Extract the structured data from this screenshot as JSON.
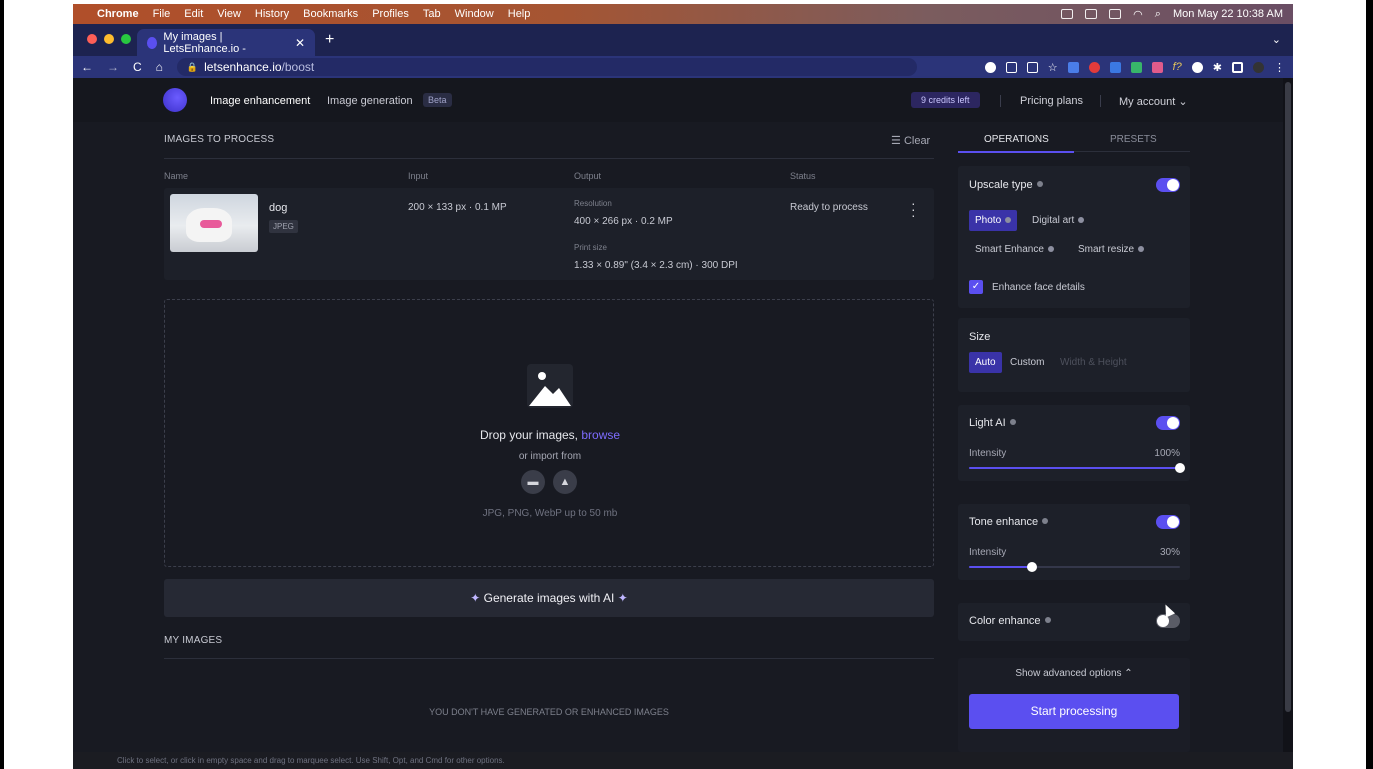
{
  "menubar": {
    "app": "Chrome",
    "items": [
      "File",
      "Edit",
      "View",
      "History",
      "Bookmarks",
      "Profiles",
      "Tab",
      "Window",
      "Help"
    ],
    "clock": "Mon May 22  10:38 AM"
  },
  "browser": {
    "tab_title": "My images | LetsEnhance.io - ",
    "url_host": "letsenhance.io",
    "url_path": "/boost"
  },
  "nav": {
    "image_enhancement": "Image enhancement",
    "image_generation": "Image generation",
    "beta": "Beta",
    "credits": "9 credits left",
    "pricing": "Pricing plans",
    "account": "My account"
  },
  "left": {
    "section_title": "IMAGES TO PROCESS",
    "clear": "Clear",
    "columns": {
      "name": "Name",
      "input": "Input",
      "output": "Output",
      "status": "Status"
    },
    "file": {
      "name": "dog",
      "type": "JPEG",
      "input": "200 × 133 px · 0.1 MP",
      "resolution_label": "Resolution",
      "resolution": "400 × 266 px · 0.2 MP",
      "print_label": "Print size",
      "print": "1.33 × 0.89\" (3.4 × 2.3 cm) · 300 DPI",
      "status": "Ready to process"
    },
    "drop": {
      "text": "Drop your images, ",
      "browse": "browse",
      "or_import": "or import from",
      "formats": "JPG, PNG, WebP up to 50 mb"
    },
    "generate": "Generate images with AI",
    "my_images_title": "MY IMAGES",
    "empty_text": "YOU DON'T HAVE GENERATED OR ENHANCED IMAGES"
  },
  "right": {
    "tabs": {
      "operations": "OPERATIONS",
      "presets": "PRESETS"
    },
    "upscale": {
      "label": "Upscale type",
      "options": [
        "Photo",
        "Digital art",
        "Smart Enhance",
        "Smart resize"
      ],
      "face": "Enhance face details"
    },
    "size": {
      "label": "Size",
      "auto": "Auto",
      "custom": "Custom",
      "wh": "Width & Height"
    },
    "light": {
      "label": "Light AI",
      "intensity_label": "Intensity",
      "intensity": "100%",
      "value": 1.0
    },
    "tone": {
      "label": "Tone enhance",
      "intensity_label": "Intensity",
      "intensity": "30%",
      "value": 0.3
    },
    "color": {
      "label": "Color enhance"
    },
    "advanced": "Show advanced options",
    "start": "Start processing"
  },
  "statusbar": "Click to select, or click in empty space and drag to marquee select. Use Shift, Opt, and Cmd for other options.",
  "colors": {
    "accent": "#5b4ff0",
    "page_bg": "#181a22"
  }
}
